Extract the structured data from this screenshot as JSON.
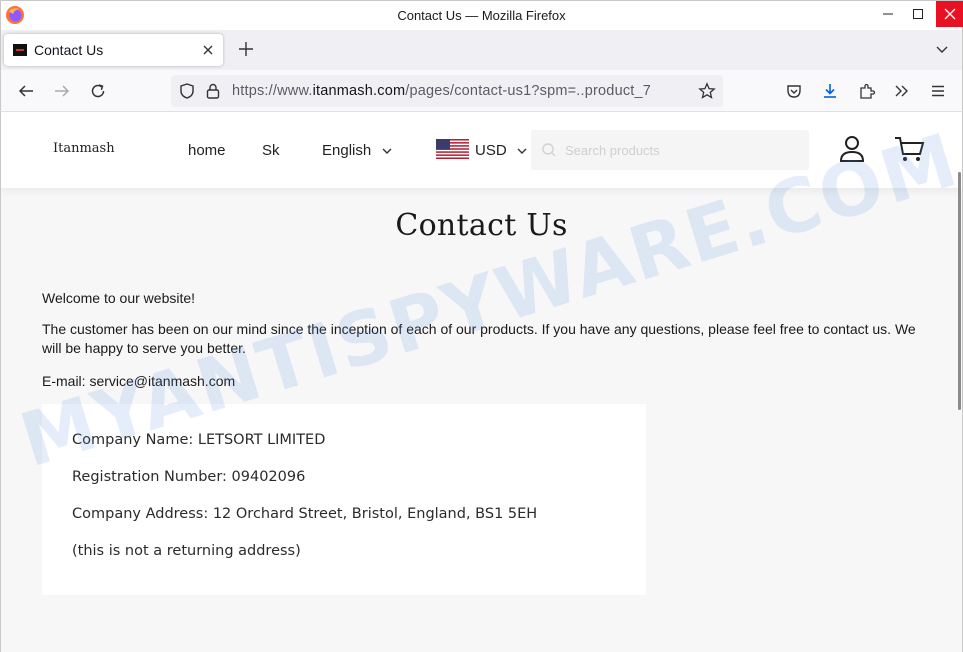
{
  "window": {
    "title": "Contact Us — Mozilla Firefox"
  },
  "tabs": [
    {
      "label": "Contact Us",
      "active": true
    }
  ],
  "urlbar": {
    "prefix": "https://www.",
    "domain": "itanmash.com",
    "path": "/pages/contact-us1?spm=..product_7"
  },
  "site": {
    "logo": "Itanmash",
    "nav": {
      "home": "home",
      "sk": "Sk"
    },
    "language": "English",
    "currency": "USD",
    "search_placeholder": "Search products"
  },
  "content": {
    "title": "Contact Us",
    "welcome": "Welcome to our website!",
    "intro": "The customer has been on our mind since the inception of each of our products. If you have any questions, please feel free to contact us. We will be happy to serve you better.",
    "email": "E-mail: service@itanmash.com",
    "company": {
      "name": "Company Name: LETSORT LIMITED",
      "registration": "Registration Number: 09402096",
      "address": "Company Address: 12 Orchard Street, Bristol, England, BS1 5EH",
      "note": "(this is not a returning address)"
    }
  },
  "watermark": "MYANTISPYWARE.COM",
  "icons": {
    "back": "arrow-left-icon",
    "forward": "arrow-right-icon",
    "reload": "reload-icon",
    "shield": "tracking-shield-icon",
    "lock": "lock-icon",
    "bookmark": "star-icon",
    "pocket": "pocket-icon",
    "downloads": "download-icon",
    "extensions": "puzzle-icon",
    "overflow": "chevrons-right-icon",
    "menu": "hamburger-icon",
    "user": "user-icon",
    "cart": "cart-icon"
  },
  "colors": {
    "close_button": "#e81123",
    "download_accent": "#0061e0",
    "page_background": "#f7f7f8",
    "flag_red": "#b22234",
    "flag_blue": "#3c3b6e"
  }
}
